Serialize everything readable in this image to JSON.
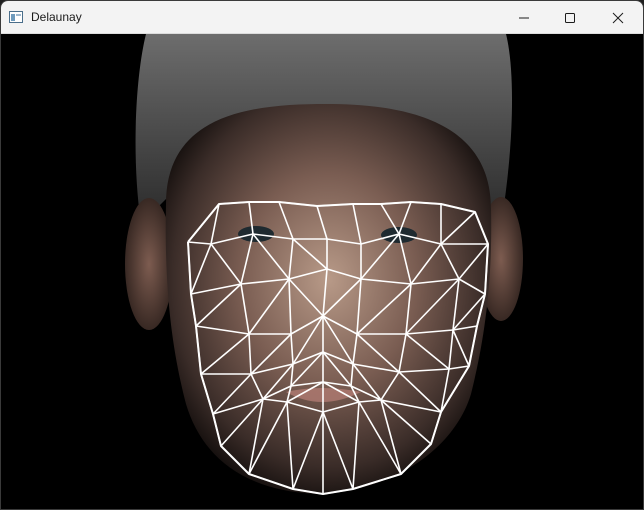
{
  "window": {
    "title": "Delaunay",
    "icon": "app-window-icon",
    "controls": [
      "minimize-icon",
      "maximize-icon",
      "close-icon"
    ]
  },
  "image": {
    "subject": "delaunay-triangulation-over-face-photo",
    "mesh_color": "#ffffff",
    "background_color": "#000000"
  }
}
